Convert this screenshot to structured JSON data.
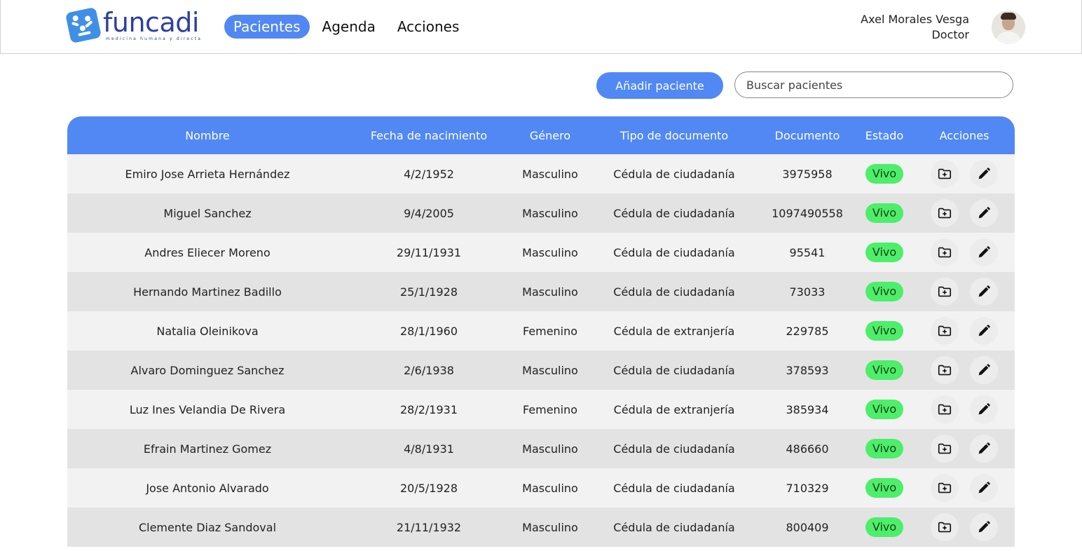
{
  "app": {
    "logo_text": "funcadi",
    "logo_tagline": "medicina humana y directa"
  },
  "nav": {
    "items": [
      {
        "label": "Pacientes",
        "active": true
      },
      {
        "label": "Agenda",
        "active": false
      },
      {
        "label": "Acciones",
        "active": false
      }
    ]
  },
  "user": {
    "name": "Axel Morales Vesga",
    "role": "Doctor"
  },
  "toolbar": {
    "add_label": "Añadir paciente",
    "search_placeholder": "Buscar pacientes",
    "search_value": ""
  },
  "table": {
    "headers": [
      "Nombre",
      "Fecha de nacimiento",
      "Género",
      "Tipo de documento",
      "Documento",
      "Estado",
      "Acciones"
    ],
    "rows": [
      {
        "nombre": "Emiro Jose Arrieta Hernández",
        "fecha": "4/2/1952",
        "genero": "Masculino",
        "tipo": "Cédula de ciudadanía",
        "documento": "3975958",
        "estado": "Vivo"
      },
      {
        "nombre": "Miguel Sanchez",
        "fecha": "9/4/2005",
        "genero": "Masculino",
        "tipo": "Cédula de ciudadanía",
        "documento": "1097490558",
        "estado": "Vivo"
      },
      {
        "nombre": "Andres Eliecer Moreno",
        "fecha": "29/11/1931",
        "genero": "Masculino",
        "tipo": "Cédula de ciudadanía",
        "documento": "95541",
        "estado": "Vivo"
      },
      {
        "nombre": "Hernando Martinez Badillo",
        "fecha": "25/1/1928",
        "genero": "Masculino",
        "tipo": "Cédula de ciudadanía",
        "documento": "73033",
        "estado": "Vivo"
      },
      {
        "nombre": "Natalia Oleinikova",
        "fecha": "28/1/1960",
        "genero": "Femenino",
        "tipo": "Cédula de extranjería",
        "documento": "229785",
        "estado": "Vivo"
      },
      {
        "nombre": "Alvaro Dominguez Sanchez",
        "fecha": "2/6/1938",
        "genero": "Masculino",
        "tipo": "Cédula de ciudadanía",
        "documento": "378593",
        "estado": "Vivo"
      },
      {
        "nombre": "Luz Ines Velandia De Rivera",
        "fecha": "28/2/1931",
        "genero": "Femenino",
        "tipo": "Cédula de extranjería",
        "documento": "385934",
        "estado": "Vivo"
      },
      {
        "nombre": "Efrain Martinez Gomez",
        "fecha": "4/8/1931",
        "genero": "Masculino",
        "tipo": "Cédula de ciudadanía",
        "documento": "486660",
        "estado": "Vivo"
      },
      {
        "nombre": "Jose Antonio Alvarado",
        "fecha": "20/5/1928",
        "genero": "Masculino",
        "tipo": "Cédula de ciudadanía",
        "documento": "710329",
        "estado": "Vivo"
      },
      {
        "nombre": "Clemente Diaz Sandoval",
        "fecha": "21/11/1932",
        "genero": "Masculino",
        "tipo": "Cédula de ciudadanía",
        "documento": "800409",
        "estado": "Vivo"
      }
    ],
    "row_icons": [
      "folder-add-icon",
      "pencil-edit-icon"
    ]
  },
  "colors": {
    "accent": "#5188f4",
    "status_alive": "#4dee6a",
    "row_odd": "#f2f2f2",
    "row_even": "#e3e3e3"
  }
}
